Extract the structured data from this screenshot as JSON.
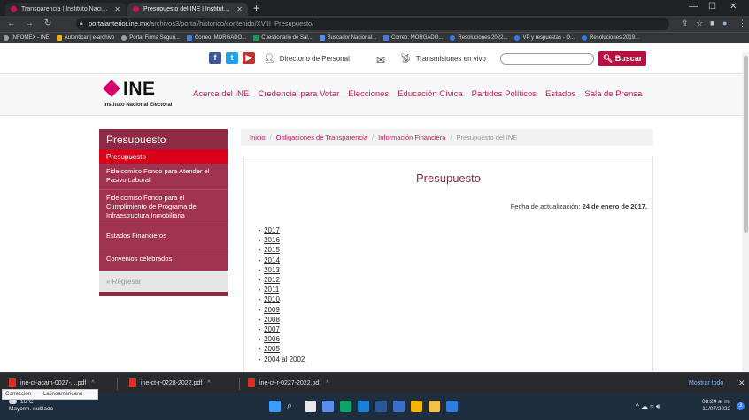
{
  "browser": {
    "tabs": [
      {
        "title": "Transparencia | Instituto Nacional"
      },
      {
        "title": "Presupuesto del INE | Instituto N..."
      }
    ],
    "new_tab": "+",
    "url_host": "portalanterior.ine.mx",
    "url_path": "/archivos3/portal/historico/contenido/XVIII_Presupuesto/",
    "bookmarks": [
      "INFOMEX - INE",
      "Autenticar | e-archivo",
      "Portal Firma Seguri...",
      "Correo: MORGADO...",
      "Cuestionario de Sal...",
      "Buscador Nacional...",
      "Correo: MORGADO...",
      "Resoluciones 2022...",
      "VP y respuestas - O...",
      "Resoluciones 2019..."
    ]
  },
  "topbar": {
    "directorio": "Directorio de Personal",
    "transmisiones": "Transmisiones en vivo",
    "buscar": "Buscar"
  },
  "header": {
    "logo_word": "INE",
    "logo_sub": "Instituto Nacional Electoral",
    "nav": [
      "Acerca del INE",
      "Credencial para Votar",
      "Elecciones",
      "Educación Cívica",
      "Partidos Políticos",
      "Estados",
      "Sala de Prensa"
    ]
  },
  "sidebar": {
    "title": "Presupuesto",
    "active": "Presupuesto",
    "items": [
      "Fideicomiso Fondo para Atender el Pasivo Laboral",
      "Fideicomiso Fondo para el Cumplimiento de Programa de Infraestructura Inmobiliaria",
      "Estados Financieros",
      "Convenios celebrados"
    ],
    "back": "« Regresar"
  },
  "breadcrumb": [
    "Inicio",
    "Obligaciones de Transparencia",
    "Información Financiera",
    "Presupuesto del INE"
  ],
  "content": {
    "title": "Presupuesto",
    "update_label": "Fecha de actualización:",
    "update_date": "24 de enero de 2017.",
    "years": [
      "2017",
      "2016",
      "2015",
      "2014",
      "2013",
      "2012",
      "2011",
      "2010",
      "2009",
      "2008",
      "2007",
      "2006",
      "2005",
      "2004 al 2002"
    ]
  },
  "downloads": {
    "items": [
      "ine-ct-acam-0027-....pdf",
      "ine-ct-r-0228-2022.pdf",
      "ine-ct-r-0227-2022.pdf"
    ],
    "show_all": "Mostrar todo",
    "tooltip": [
      "Corrección",
      "Latinoamericano"
    ]
  },
  "taskbar": {
    "temp": "16°C",
    "weather": "Mayorm. nublado",
    "time": "08:24 a. m.",
    "date": "11/07/2022",
    "notifications": "3"
  },
  "colors": {
    "ine_magenta": "#c2185b",
    "sidebar_wine": "#8e2a44",
    "active_red": "#d9001b",
    "buscar_red": "#b5103f"
  }
}
